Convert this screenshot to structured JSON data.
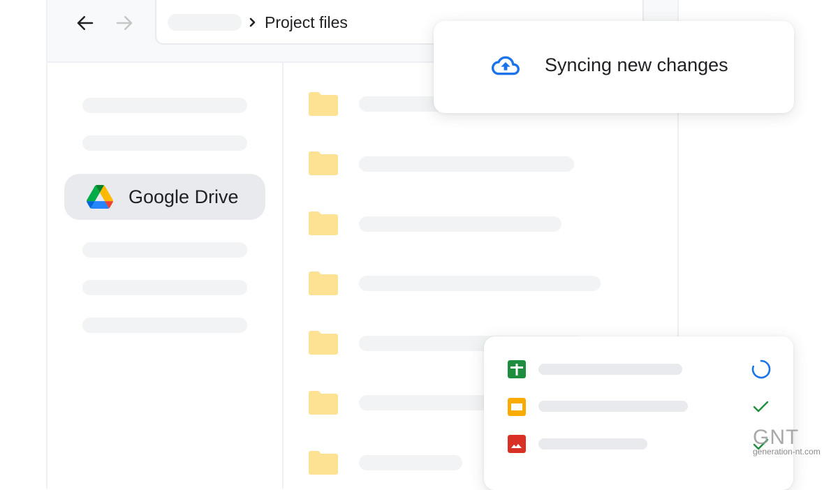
{
  "toolbar": {
    "back_icon": "arrow-left-icon",
    "forward_icon": "arrow-right-icon",
    "breadcrumb": {
      "separator_icon": "chevron-right-icon",
      "current": "Project files"
    }
  },
  "sidebar": {
    "selected_item": {
      "label": "Google Drive",
      "icon": "google-drive-logo"
    },
    "placeholder_items": 5
  },
  "file_list": {
    "items": [
      {
        "icon": "folder-icon"
      },
      {
        "icon": "folder-icon"
      },
      {
        "icon": "folder-icon"
      },
      {
        "icon": "folder-icon"
      },
      {
        "icon": "folder-icon"
      },
      {
        "icon": "folder-icon"
      },
      {
        "icon": "folder-icon"
      }
    ]
  },
  "sync_notification": {
    "icon": "cloud-upload-icon",
    "text": "Syncing new changes"
  },
  "upload_panel": {
    "items": [
      {
        "type": "sheets",
        "icon": "google-sheets-icon",
        "color": "#1e8e3e",
        "status": "syncing"
      },
      {
        "type": "slides",
        "icon": "google-slides-icon",
        "color": "#f9ab00",
        "status": "done"
      },
      {
        "type": "image",
        "icon": "image-file-icon",
        "color": "#d93025",
        "status": "done"
      }
    ]
  },
  "colors": {
    "accent_blue": "#1a73e8",
    "success_green": "#1e8e3e",
    "folder_yellow": "#fde293"
  },
  "watermark": {
    "logo": "GNT",
    "site": "generation-nt.com"
  }
}
